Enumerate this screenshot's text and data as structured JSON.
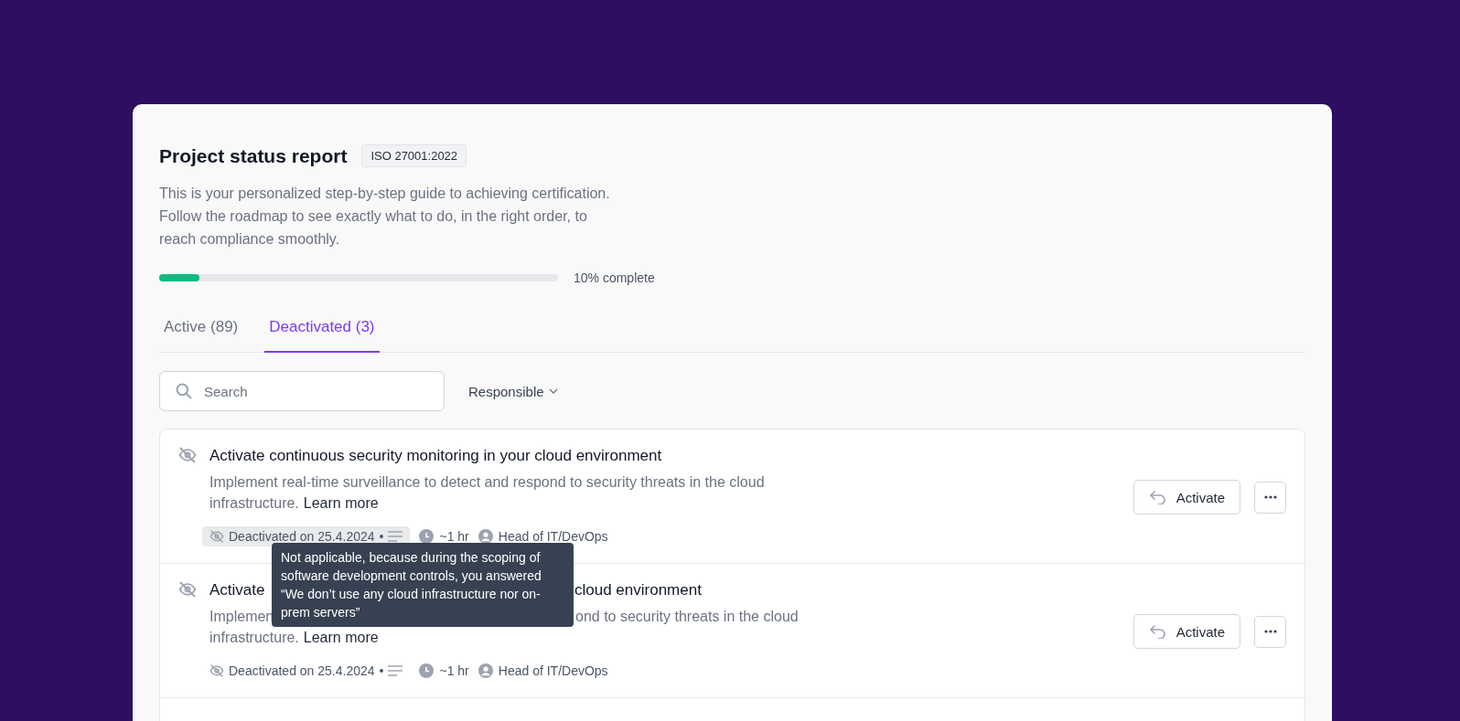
{
  "header": {
    "title": "Project status report",
    "badge": "ISO 27001:2022",
    "description": "This is your personalized step-by-step guide to achieving certification. Follow the roadmap to see exactly what to do, in the right order, to reach compliance smoothly."
  },
  "progress": {
    "level": 0.1,
    "label": "10% complete"
  },
  "tabs": [
    {
      "label": "Active (89)",
      "selected": false
    },
    {
      "label": "Deactivated (3)",
      "selected": true
    }
  ],
  "search": {
    "placeholder": "Search"
  },
  "filter": {
    "label": "Responsible"
  },
  "items": [
    {
      "title_parts": [
        "Activate continuous security monitoring in your cloud environment"
      ],
      "description_parts": [
        "Implement real-time surveillance to detect and respond to security threats in the cloud"
      ],
      "description_end": "infrastructure.",
      "link": "Learn more",
      "deactivated": "Deactivated on 25.4.2024",
      "separator": "•",
      "highlighted": true,
      "duration": "~1 hr",
      "responsible": "Head of IT/DevOps",
      "action": "Activate"
    },
    {
      "title_parts": [
        "Activate",
        "cloud environment"
      ],
      "description_parts": [
        "Implemen",
        "ond to security threats in the cloud"
      ],
      "description_end": "infrastructure.",
      "link": "Learn more",
      "deactivated": "Deactivated on 25.4.2024",
      "separator": "•",
      "highlighted": false,
      "duration": "~1 hr",
      "responsible": "Head of IT/DevOps",
      "action": "Activate"
    }
  ],
  "tooltip": "Not applicable, because during the scoping of software development controls, you answered “We don’t use any cloud infrastructure nor on-prem servers”"
}
